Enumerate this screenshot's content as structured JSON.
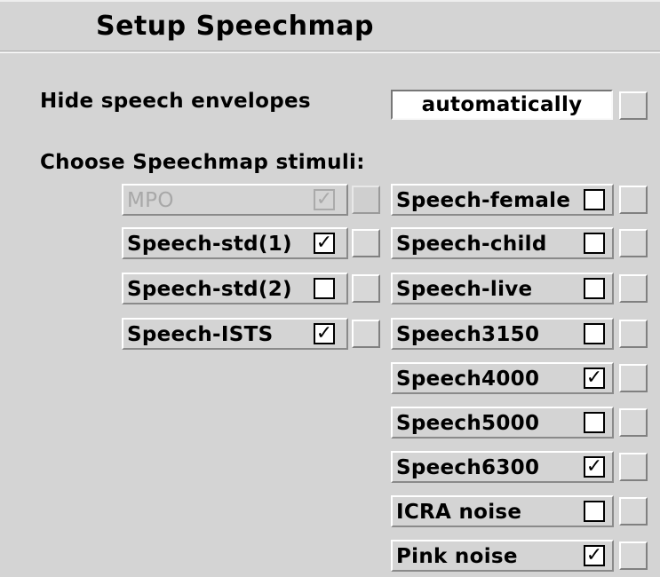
{
  "title": "Setup Speechmap",
  "hide_envelopes": {
    "label": "Hide speech envelopes",
    "value": "automatically"
  },
  "stimuli_label": "Choose Speechmap stimuli:",
  "left_stimuli": [
    {
      "label": "MPO",
      "checked": true,
      "disabled": true
    },
    {
      "label": "Speech-std(1)",
      "checked": true,
      "disabled": false
    },
    {
      "label": "Speech-std(2)",
      "checked": false,
      "disabled": false
    },
    {
      "label": "Speech-ISTS",
      "checked": true,
      "disabled": false
    }
  ],
  "right_stimuli": [
    {
      "label": "Speech-female",
      "checked": false
    },
    {
      "label": "Speech-child",
      "checked": false
    },
    {
      "label": "Speech-live",
      "checked": false
    },
    {
      "label": "Speech3150",
      "checked": false
    },
    {
      "label": "Speech4000",
      "checked": true
    },
    {
      "label": "Speech5000",
      "checked": false
    },
    {
      "label": "Speech6300",
      "checked": true
    },
    {
      "label": "ICRA noise",
      "checked": false
    },
    {
      "label": "Pink noise",
      "checked": true
    }
  ],
  "checkmark_glyph": "✓"
}
